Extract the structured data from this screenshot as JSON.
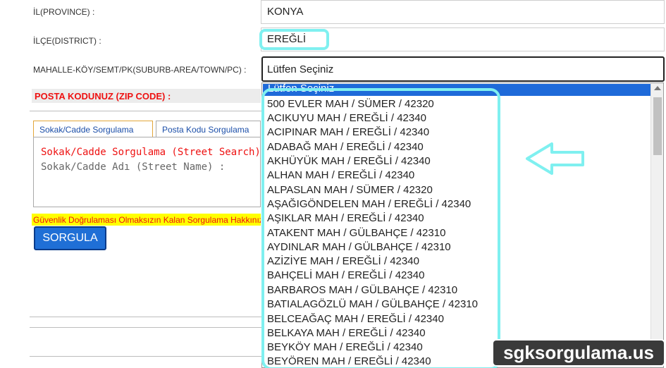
{
  "form": {
    "province_label": "İL(PROVINCE) :",
    "province_value": "KONYA",
    "district_label": "İLÇE(DISTRICT) :",
    "district_value": "EREĞLİ",
    "suburb_label": "MAHALLE-KÖY/SEMT/PK(SUBURB-AREA/TOWN/PC) :",
    "suburb_selected": "Lütfen Seçiniz",
    "zip_label": "POSTA KODUNUZ (ZIP CODE) :"
  },
  "tabs": [
    {
      "label": "Sokak/Cadde Sorgulama"
    },
    {
      "label": "Posta Kodu Sorgulama"
    }
  ],
  "street_search": {
    "title": "Sokak/Cadde Sorgulama (Street Search)",
    "name_label": "Sokak/Cadde Adı (Street Name) :"
  },
  "warning_text": "Güvenlik Doğrulaması Olmaksızın Kalan Sorgulama Hakkınız",
  "search_button": "SORGULA",
  "dropdown": {
    "selected_option": "Lütfen Seçiniz",
    "options": [
      "500 EVLER MAH / SÜMER / 42320",
      "ACIKUYU MAH / EREĞLİ / 42340",
      "ACIPINAR MAH / EREĞLİ / 42340",
      "ADABAĞ MAH / EREĞLİ / 42340",
      "AKHÜYÜK MAH / EREĞLİ / 42340",
      "ALHAN MAH / EREĞLİ / 42340",
      "ALPASLAN MAH / SÜMER / 42320",
      "AŞAĞIGÖNDELEN MAH / EREĞLİ / 42340",
      "AŞIKLAR MAH / EREĞLİ / 42340",
      "ATAKENT MAH / GÜLBAHÇE / 42310",
      "AYDINLAR MAH / GÜLBAHÇE / 42310",
      "AZİZİYE MAH / EREĞLİ / 42340",
      "BAHÇELİ MAH / EREĞLİ / 42340",
      "BARBAROS MAH / GÜLBAHÇE / 42310",
      "BATIALAGÖZLÜ MAH / GÜLBAHÇE / 42310",
      "BELCEAĞAÇ MAH / EREĞLİ / 42340",
      "BELKAYA MAH / EREĞLİ / 42340",
      "BEYKÖY MAH / EREĞLİ / 42340",
      "BEYÖREN MAH / EREĞLİ / 42340"
    ]
  },
  "overlay": {
    "arrow_icon": "left-arrow-icon",
    "highlight_color": "#7ff0f0"
  },
  "watermark": "sgksorgulama.us",
  "colors": {
    "accent_blue": "#1e6ad9",
    "label_red": "#e11111",
    "warning_yellow": "#ffff00"
  }
}
